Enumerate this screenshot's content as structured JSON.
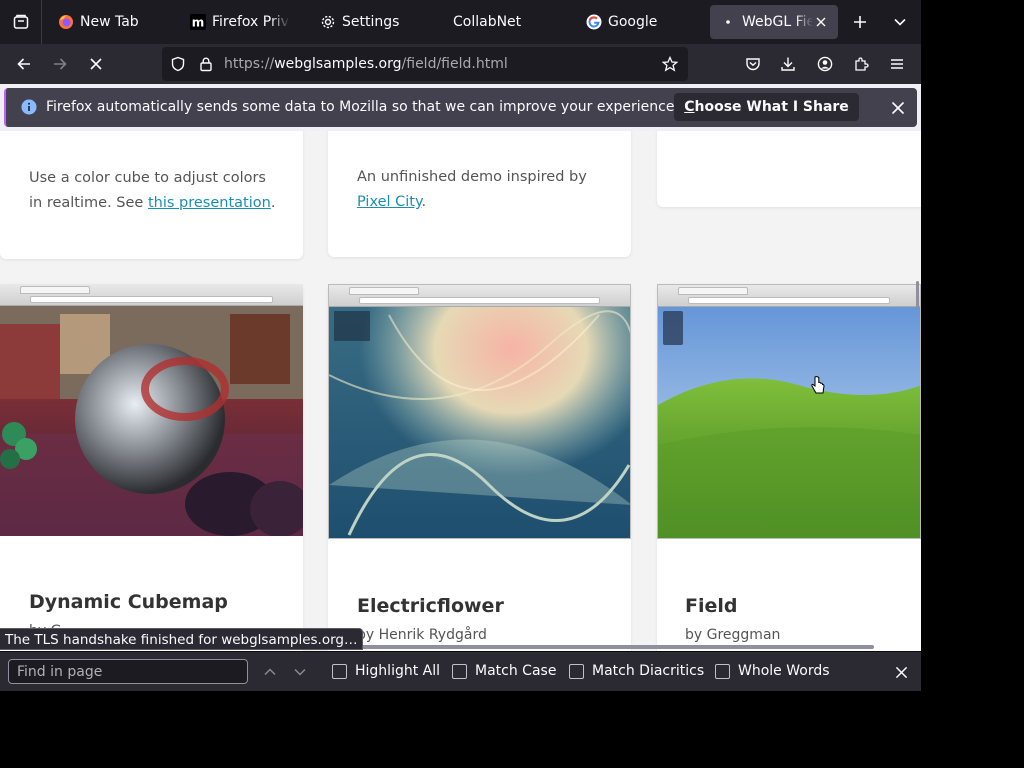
{
  "tabs": [
    {
      "label": "New Tab",
      "icon": "firefox-icon",
      "active": false
    },
    {
      "label": "Firefox Privac",
      "icon": "mozilla-m-icon",
      "active": false
    },
    {
      "label": "Settings",
      "icon": "gear-icon",
      "active": false
    },
    {
      "label": "CollabNet",
      "icon": "",
      "active": false
    },
    {
      "label": "Google",
      "icon": "google-g-icon",
      "active": false
    },
    {
      "label": "WebGL Fiel",
      "icon": "dot-icon",
      "active": true
    }
  ],
  "nav": {
    "url_scheme": "https://",
    "url_host": "webglsamples.org",
    "url_path": "/field/field.html"
  },
  "notification": {
    "text": "Firefox automatically sends some data to Mozilla so that we can improve your experience.",
    "button_accel": "C",
    "button_rest": "hoose What I Share"
  },
  "cards_top": [
    {
      "desc_before": "Use a color cube to adjust colors in realtime. See ",
      "link": "this presentation",
      "desc_after": "."
    },
    {
      "desc_before": "An unfinished demo inspired by ",
      "link": "Pixel City",
      "desc_after": "."
    }
  ],
  "cards": [
    {
      "title": "Dynamic Cubemap",
      "author": "by G"
    },
    {
      "title": "Electricflower",
      "author": "by Henrik Rydgård"
    },
    {
      "title": "Field",
      "author": "by Greggman"
    }
  ],
  "status_text": "The TLS handshake finished for webglsamples.org…",
  "findbar": {
    "placeholder": "Find in page",
    "highlight_all": "Highlight All",
    "match_case": "Match Case",
    "match_diacritics": "Match Diacritics",
    "whole_words": "Whole Words"
  },
  "colors": {
    "accent_link": "#1a8fb3",
    "toolbar": "#2b2a33",
    "tabstrip": "#1c1b22",
    "notification_bar": "#42414d",
    "notification_accent": "#c161ff"
  }
}
